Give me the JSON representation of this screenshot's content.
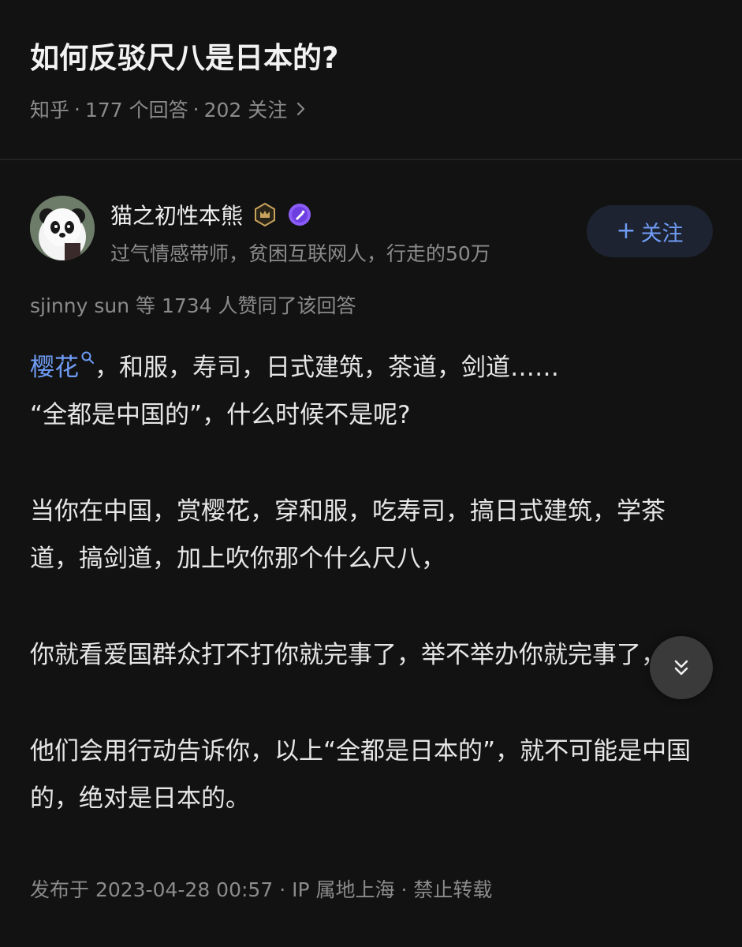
{
  "question": {
    "title": "如何反驳尺八是日本的?",
    "source": "知乎",
    "answers_count": "177 个回答",
    "followers_count": "202 关注",
    "separator": "·"
  },
  "author": {
    "name": "猫之初性本熊",
    "bio": "过气情感带师，贫困互联网人，行走的50万",
    "badges": [
      "crown-badge-icon",
      "pen-badge-icon"
    ],
    "follow_label": "关注",
    "follow_plus": "+"
  },
  "upvote_line": "sjinny sun 等 1734 人赞同了该回答",
  "answer": {
    "p1_link": "樱花",
    "p1_rest": "，和服，寿司，日式建筑，茶道，剑道……",
    "p1_line2": "“全都是中国的”，什么时候不是呢?",
    "p2": "当你在中国，赏樱花，穿和服，吃寿司，搞日式建筑，学茶道，搞剑道，加上吹你那个什么尺八，",
    "p3": "你就看爱国群众打不打你就完事了，举不举办你就完事了，",
    "p4": "他们会用行动告诉你，以上“全都是日本的”，就不可能是中国的，绝对是日本的。"
  },
  "footer": {
    "published": "发布于 2023-04-28 00:57",
    "ip": "IP 属地上海",
    "copyright": "禁止转载",
    "separator": "·"
  },
  "colors": {
    "background": "#121212",
    "link": "#6f9cf5",
    "muted": "#8b8b8b",
    "follow_bg": "#1d2330",
    "crown_gold": "#c9a25b",
    "pen_purple": "#8b5cf6"
  }
}
